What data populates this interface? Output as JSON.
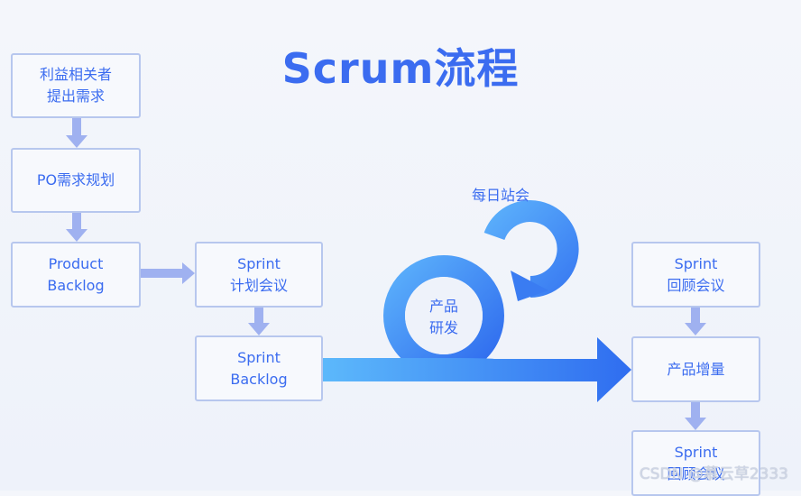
{
  "title": "Scrum流程",
  "boxes": {
    "stakeholder": "利益相关者\n提出需求",
    "po_planning": "PO需求规划",
    "product_backlog": "Product\nBacklog",
    "sprint_planning": "Sprint\n计划会议",
    "sprint_backlog": "Sprint\nBacklog",
    "sprint_retro": "Sprint\n回顾会议",
    "increment": "产品增量",
    "sprint_review": "Sprint\n回顾会议"
  },
  "loop": {
    "daily_standup": "每日站会",
    "development": "产品\n研发"
  },
  "watermark": "CSDN @慕云草2333",
  "colors": {
    "accent": "#3b6cf0",
    "box_border": "#b7c7ee",
    "connector": "#9fb1f0",
    "flow_light": "#5cb8fb",
    "flow_dark": "#2f6df0"
  }
}
